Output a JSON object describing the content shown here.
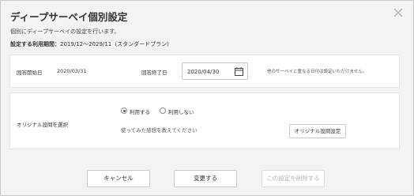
{
  "dialog": {
    "title": "ディープサーベイ個別設定",
    "description": "個別にディープサーベイの設定を行います。",
    "period_label": "設定する利用期間：",
    "period_value": "2019/12〜2029/11（スタンダードプラン）"
  },
  "dates": {
    "start_label": "回答開始日",
    "start_value": "2020/03/31",
    "end_label": "回答終了日",
    "end_value": "2020/04/30",
    "note": "他のサーベイと重なる日付は設定いただけません。"
  },
  "original_question": {
    "label": "オリジナル設問を選択",
    "option_use": "利用する",
    "option_not_use": "利用しない",
    "selected": "利用する",
    "question_text": "使ってみた感想を教えてください",
    "settings_button": "オリジナル設問設定"
  },
  "footer": {
    "cancel": "キャンセル",
    "change": "変更する",
    "delete": "この設定を削除する"
  }
}
